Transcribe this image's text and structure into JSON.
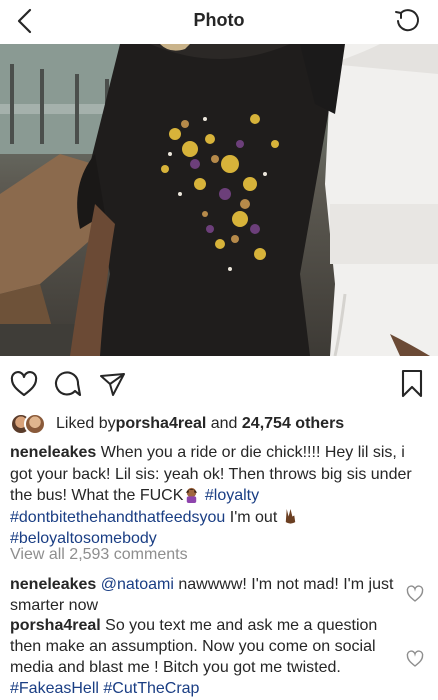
{
  "header": {
    "title": "Photo"
  },
  "likes": {
    "prefix": "Liked by ",
    "user": "porsha4real",
    "middle": " and ",
    "count": "24,754 others"
  },
  "caption": {
    "user": "neneleakes",
    "text1": " When you a ride or die chick!!!! Hey lil sis, i got your back! Lil sis: yeah ok! Then throws big sis under the bus! What the FUCK",
    "tag_loyalty": "#loyalty",
    "tag_dontbite": "#dontbitethehandthatfeedsyou",
    "text2": " I'm out",
    "tag_beloyal": "#beloyaltosomebody"
  },
  "view_all": "View all 2,593 comments",
  "comments": [
    {
      "user": "neneleakes",
      "mention": "@natoami",
      "text": " nawwww! I'm not mad! I'm just smarter now"
    },
    {
      "user": "porsha4real",
      "text": " So you text me and ask me a question then make an assumption. Now you come on social media and blast me ! Bitch you got me twisted. ",
      "tag1": "#FakeasHell",
      "tag2": "#CutTheCrap"
    }
  ],
  "colors": {
    "text": "#262626",
    "secondary": "#8e8e8e",
    "hashtag": "#1a3e84"
  },
  "icons": [
    "back-chevron-icon",
    "refresh-icon",
    "heart-icon",
    "comment-icon",
    "share-icon",
    "bookmark-icon"
  ]
}
